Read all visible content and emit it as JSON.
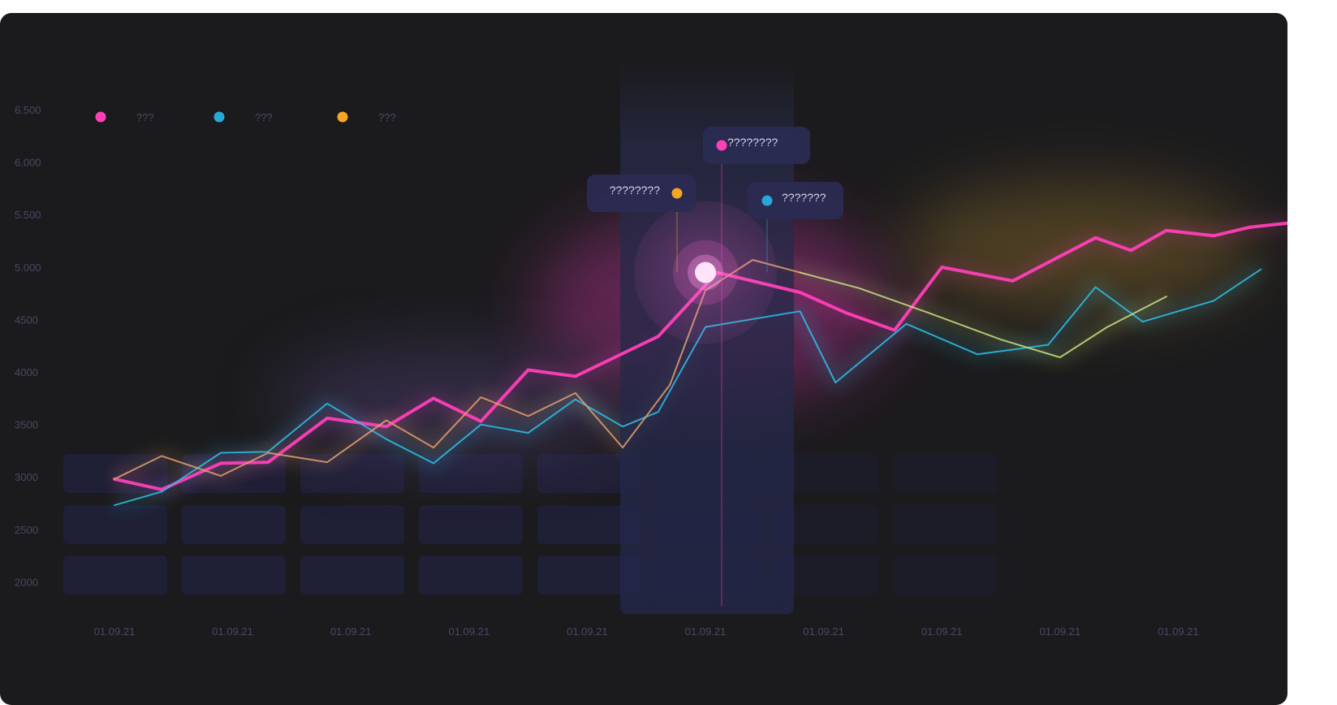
{
  "chart_data": {
    "type": "line",
    "y_ticks": [
      "6.500",
      "6.000",
      "5.500",
      "5.000",
      "4500",
      "4000",
      "3500",
      "3000",
      "2500",
      "2000"
    ],
    "ylim": [
      2000,
      6500
    ],
    "categories": [
      "01.09.21",
      "01.09.21",
      "01.09.21",
      "01.09.21",
      "01.09.21",
      "01.09.21",
      "01.09.21",
      "01.09.21",
      "01.09.21",
      "01.09.21"
    ],
    "legend": [
      {
        "label": "???",
        "color": "#ff3fb8"
      },
      {
        "label": "???",
        "color": "#27a8d8"
      },
      {
        "label": "???",
        "color": "#f5a623"
      }
    ],
    "series": [
      {
        "color": "#ff3fb8",
        "x": [
          0.0,
          0.4,
          0.9,
          1.3,
          1.8,
          2.3,
          2.7,
          3.1,
          3.5,
          3.9,
          4.6,
          5.1,
          5.8,
          6.2,
          6.6,
          7.0,
          7.6,
          8.3,
          8.6,
          8.9,
          9.3,
          9.6,
          10.0
        ],
        "y": [
          2900,
          2800,
          3050,
          3060,
          3480,
          3400,
          3670,
          3450,
          3940,
          3880,
          4260,
          4870,
          4680,
          4480,
          4320,
          4920,
          4790,
          5200,
          5080,
          5270,
          5220,
          5300,
          5350
        ]
      },
      {
        "color": "#2fbfe8",
        "x": [
          0.0,
          0.4,
          0.9,
          1.3,
          1.8,
          2.3,
          2.7,
          3.1,
          3.5,
          3.9,
          4.3,
          4.6,
          5.0,
          5.8,
          6.1,
          6.7,
          7.3,
          7.9,
          8.3,
          8.7,
          9.3,
          9.7
        ],
        "y": [
          2650,
          2780,
          3150,
          3160,
          3620,
          3280,
          3050,
          3420,
          3340,
          3660,
          3400,
          3540,
          4350,
          4500,
          3820,
          4380,
          4090,
          4180,
          4730,
          4400,
          4600,
          4900
        ]
      },
      {
        "color": "#e0a070",
        "x": [
          0.0,
          0.4,
          0.9,
          1.3,
          1.8,
          2.3,
          2.7,
          3.1,
          3.5,
          3.9,
          4.3,
          4.7,
          5.0,
          5.4,
          5.8
        ],
        "y": [
          2900,
          3120,
          2930,
          3150,
          3060,
          3460,
          3200,
          3680,
          3500,
          3720,
          3200,
          3800,
          4700,
          4990,
          4870
        ]
      },
      {
        "color": "#c8e080",
        "x": [
          5.8,
          6.3,
          6.9,
          7.5,
          8.0,
          8.4,
          8.9
        ],
        "y": [
          4870,
          4720,
          4480,
          4230,
          4060,
          4350,
          4640
        ]
      }
    ]
  },
  "tooltips": [
    {
      "label": "????????",
      "color": "#ff3fb8"
    },
    {
      "label": "????????",
      "color": "#f5a623"
    },
    {
      "label": "???????",
      "color": "#27a8d8"
    }
  ]
}
